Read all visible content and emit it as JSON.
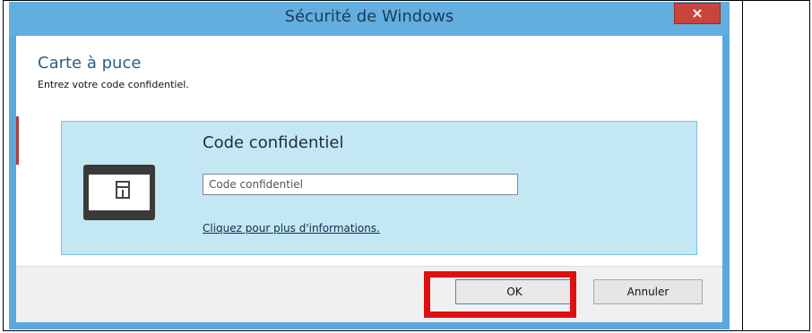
{
  "window": {
    "title": "Sécurité de Windows",
    "close_glyph": "×"
  },
  "header": {
    "title": "Carte à puce",
    "subtitle": "Entrez votre code confidentiel."
  },
  "tile": {
    "icon": "smart-card-reader-icon",
    "field_label": "Code confidentiel",
    "pin_placeholder": "Code confidentiel",
    "pin_value": "",
    "info_link": "Cliquez pour plus d'informations."
  },
  "buttons": {
    "ok": "OK",
    "cancel": "Annuler"
  },
  "colors": {
    "titlebar": "#62aedf",
    "close": "#c9443a",
    "tile": "#c4e7f4",
    "highlight": "#e01010"
  }
}
